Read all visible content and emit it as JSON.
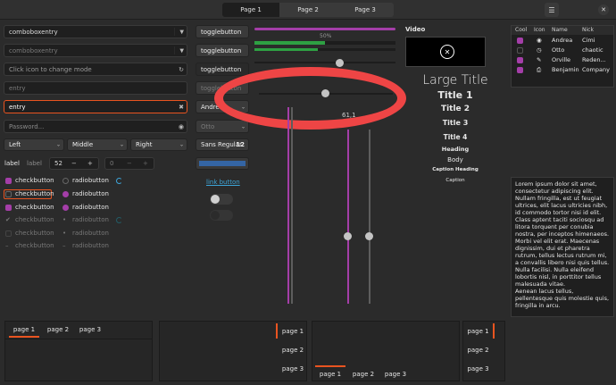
{
  "top_tabs": [
    "Page 1",
    "Page 2",
    "Page 3"
  ],
  "menu_icon": "hamburger-icon",
  "close_icon": "close-icon",
  "combos": {
    "combo1": "comboboxentry",
    "combo2": "comboboxentry",
    "mode_placeholder": "Click icon to change mode",
    "entry_placeholder": "entry",
    "entry_value": "entry",
    "password_placeholder": "Password..."
  },
  "dropdowns": [
    "Left",
    "Middle",
    "Right"
  ],
  "spin_row": {
    "label1": "label",
    "label2": "label",
    "spin_value": "52",
    "spin2_value": "0"
  },
  "checks": [
    {
      "check": "checkbutton",
      "radio": "radiobutton"
    },
    {
      "check": "checkbutton",
      "radio": "radiobutton"
    },
    {
      "check": "checkbutton",
      "radio": "radiobutton"
    },
    {
      "check": "checkbutton",
      "radio": "radiobutton"
    },
    {
      "check": "checkbutton",
      "radio": "radiobutton"
    },
    {
      "check": "checkbutton",
      "radio": "radiobutton"
    }
  ],
  "toggles": [
    "togglebutton",
    "togglebutton",
    "togglebutton",
    "togglebutton"
  ],
  "combo_andrea": "Andrea",
  "combo_otto": "Otto",
  "font_button": {
    "name": "Sans Regular",
    "size": "12"
  },
  "link_button": "link button",
  "progress": {
    "label": "50%",
    "value": 0.5,
    "bar2": 0.45
  },
  "scale_value": "61,1",
  "video_title": "Video",
  "typography": [
    "Large Title",
    "Title 1",
    "Title 2",
    "Title 3",
    "Title 4",
    "Heading",
    "Body",
    "Caption Heading",
    "Caption"
  ],
  "tree": {
    "headers": [
      "Cool",
      "Icon",
      "Name",
      "Nick"
    ],
    "rows": [
      {
        "name": "Andrea",
        "nick": "Cimi",
        "icon": "check-circle-icon"
      },
      {
        "name": "Otto",
        "nick": "chaotic",
        "icon": "clock-icon"
      },
      {
        "name": "Orville",
        "nick": "Reden...",
        "icon": "edit-icon"
      },
      {
        "name": "Benjamin",
        "nick": "Company",
        "icon": "printer-icon"
      }
    ]
  },
  "lorem": "Lorem ipsum dolor sit amet, consectetur adipiscing elit. Nullam fringilla, est ut feugiat ultrices, elit lacus ultricies nibh, id commodo tortor nisi id elit. Class aptent taciti sociosqu ad litora torquent per conubia nostra, per inceptos himenaeos.\nMorbi vel elit erat. Maecenas dignissim, dui et pharetra rutrum, tellus lectus rutrum mi, a convallis libero nisi quis tellus.\nNulla facilisi. Nulla eleifend lobortis nisl, in porttitor tellus malesuada vitae.\nAenean lacus tellus, pellentesque quis molestie quis, fringilla in arcu.",
  "notebook_tabs": [
    "page 1",
    "page 2",
    "page 3"
  ],
  "colors": {
    "accent": "#e95420",
    "purple": "#a43ea8",
    "green": "#2ea043",
    "blue": "#3465a4"
  }
}
